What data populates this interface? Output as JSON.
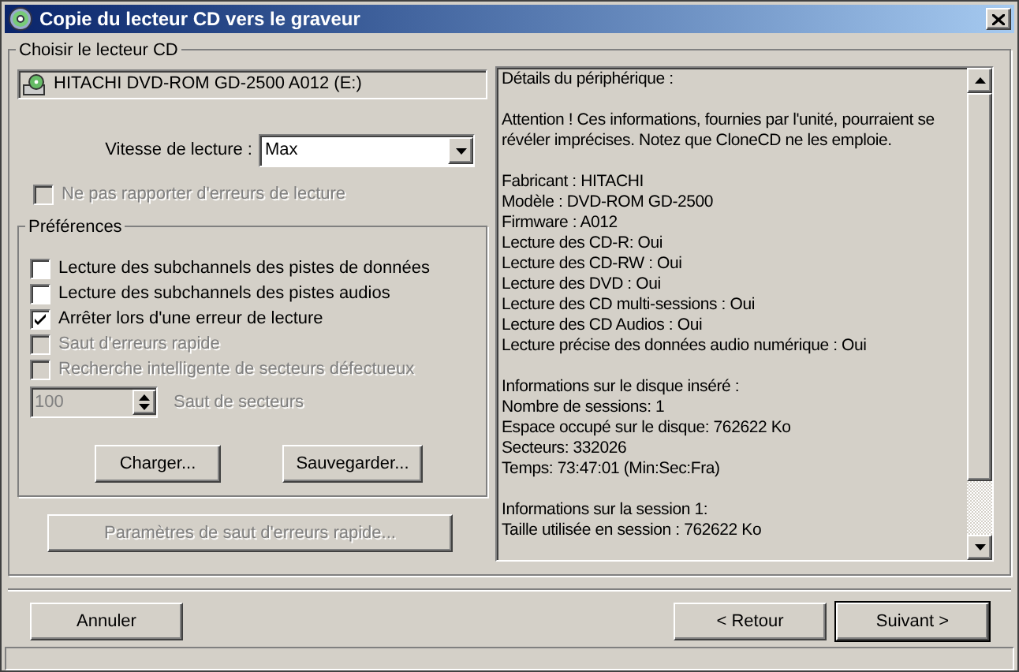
{
  "window": {
    "title": "Copie du lecteur CD vers le graveur"
  },
  "drive_group": {
    "title": "Choisir le lecteur CD",
    "drive": {
      "label": "HITACHI DVD-ROM GD-2500 A012 (E:)",
      "selected": false
    },
    "speed": {
      "label": "Vitesse de lecture :",
      "value": "Max"
    },
    "no_errors": {
      "label": "Ne pas rapporter d'erreurs de lecture",
      "checked": false,
      "disabled": true
    },
    "preferences": {
      "title": "Préférences",
      "options": [
        {
          "label": "Lecture des subchannels des pistes de données",
          "checked": false,
          "disabled": false
        },
        {
          "label": "Lecture des subchannels des pistes audios",
          "checked": false,
          "disabled": false
        },
        {
          "label": "Arrêter lors d'une erreur de lecture",
          "checked": true,
          "disabled": false
        },
        {
          "label": "Saut d'erreurs rapide",
          "checked": false,
          "disabled": true
        },
        {
          "label": "Recherche intelligente de secteurs défectueux",
          "checked": false,
          "disabled": true
        }
      ],
      "sector_skip": {
        "value": "100",
        "label": "Saut de secteurs",
        "disabled": true
      },
      "buttons": [
        "Charger...",
        "Sauvegarder..."
      ]
    },
    "skip_params_button": {
      "label": "Paramètres de saut d'erreurs rapide...",
      "disabled": true
    },
    "details": [
      [
        "Détails du périphérique :"
      ],
      [
        "Attention ! Ces informations, fournies par l'unité, pourraient se révéler imprécises. Notez que CloneCD ne les emploie."
      ],
      [
        "Fabricant : HITACHI",
        "Modèle : DVD-ROM GD-2500",
        "Firmware : A012",
        "Lecture des CD-R: Oui",
        "Lecture des CD-RW : Oui",
        "Lecture des DVD : Oui",
        "Lecture des CD multi-sessions : Oui",
        "Lecture des CD Audios : Oui",
        "Lecture précise des données audio numérique : Oui"
      ],
      [
        "Informations sur le disque inséré :",
        "Nombre de sessions: 1",
        "Espace occupé sur le disque: 762622 Ko",
        "Secteurs: 332026",
        "Temps: 73:47:01 (Min:Sec:Fra)"
      ],
      [
        "Informations sur la session 1:",
        "Taille utilisée en session : 762622 Ko"
      ]
    ]
  },
  "footer": {
    "buttons": [
      {
        "label": "Annuler",
        "default": false
      },
      {
        "label": "< Retour",
        "default": false
      },
      {
        "label": "Suivant >",
        "default": true
      }
    ]
  }
}
